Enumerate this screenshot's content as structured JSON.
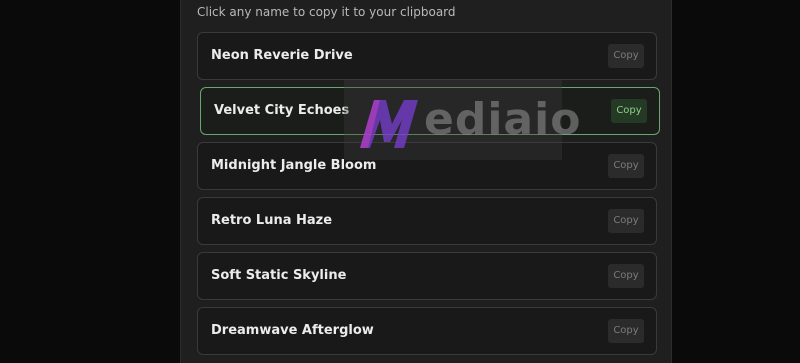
{
  "hint": "Click any name to copy it to your clipboard",
  "items": [
    {
      "name": "Neon Reverie Drive",
      "copy_label": "Copy"
    },
    {
      "name": "Velvet City Echoes",
      "copy_label": "Copy"
    },
    {
      "name": "Midnight Jangle Bloom",
      "copy_label": "Copy"
    },
    {
      "name": "Retro Luna Haze",
      "copy_label": "Copy"
    },
    {
      "name": "Soft Static Skyline",
      "copy_label": "Copy"
    },
    {
      "name": "Dreamwave Afterglow",
      "copy_label": "Copy"
    }
  ],
  "watermark": {
    "text": "ediaio",
    "logo_icon": "m-logo-icon"
  },
  "colors": {
    "active_border": "#6aa76a",
    "active_copy_text": "#8ccf8c",
    "watermark_logo": "#7a3fd6"
  }
}
